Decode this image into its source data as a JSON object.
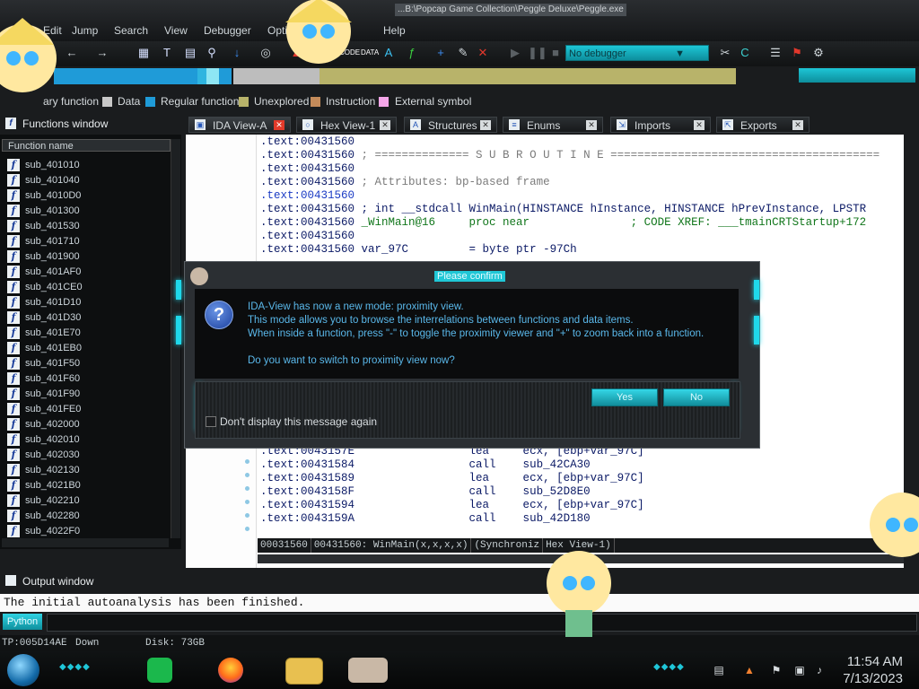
{
  "window": {
    "title_path": "...B:\\Popcap Game Collection\\Peggle Deluxe\\Peggle.exe"
  },
  "menu": [
    "Edit",
    "Jump",
    "Search",
    "View",
    "Debugger",
    "Opti",
    "Help"
  ],
  "toolbar": {
    "debugger_combo": "No debugger"
  },
  "legend": [
    {
      "label": "ary function",
      "color": "#e0e0e0"
    },
    {
      "label": "Data",
      "color": "#c8c8c8"
    },
    {
      "label": "Regular function",
      "color": "#1f9bd8"
    },
    {
      "label": "Unexplored",
      "color": "#b8b36a"
    },
    {
      "label": "Instruction",
      "color": "#c48b5a"
    },
    {
      "label": "External symbol",
      "color": "#f4a6e8"
    }
  ],
  "functions_window": {
    "title": "Functions window",
    "column": "Function name",
    "items": [
      "sub_401010",
      "sub_401040",
      "sub_4010D0",
      "sub_401300",
      "sub_401530",
      "sub_401710",
      "sub_401900",
      "sub_401AF0",
      "sub_401CE0",
      "sub_401D10",
      "sub_401D30",
      "sub_401E70",
      "sub_401EB0",
      "sub_401F50",
      "sub_401F60",
      "sub_401F90",
      "sub_401FE0",
      "sub_402000",
      "sub_402010",
      "sub_402030",
      "sub_402130",
      "sub_4021B0",
      "sub_402210",
      "sub_402280",
      "sub_4022F0"
    ]
  },
  "tabs": [
    {
      "label": "IDA View-A",
      "icon": "ida-view-icon",
      "active": true
    },
    {
      "label": "Hex View-1",
      "icon": "hex-view-icon"
    },
    {
      "label": "Structures",
      "icon": "structures-icon"
    },
    {
      "label": "Enums",
      "icon": "enums-icon"
    },
    {
      "label": "Imports",
      "icon": "imports-icon"
    },
    {
      "label": "Exports",
      "icon": "exports-icon"
    }
  ],
  "code": {
    "top": [
      {
        "a": ".text:00431560",
        "b": ""
      },
      {
        "a": ".text:00431560",
        "b": " ; ============== S U B R O U T I N E ========================================"
      },
      {
        "a": ".text:00431560",
        "b": ""
      },
      {
        "a": ".text:00431560",
        "b": " ; Attributes: bp-based frame"
      },
      {
        "a": ".text:00431560",
        "b": ""
      },
      {
        "a": ".text:00431560",
        "b": " ; int __stdcall WinMain(HINSTANCE hInstance, HINSTANCE hPrevInstance, LPSTR"
      },
      {
        "a": ".text:00431560",
        "b": " _WinMain@16     proc near               ; CODE XREF: ___tmainCRTStartup+172"
      },
      {
        "a": ".text:00431560",
        "b": ""
      },
      {
        "a": ".text:00431560",
        "b": " var_97C         = byte ptr -97Ch"
      }
    ],
    "bottom": [
      {
        "a": ".text:0043157E",
        "b": "                 lea     ecx, [ebp+var_97C]"
      },
      {
        "a": ".text:00431584",
        "b": "                 call    sub_42CA30"
      },
      {
        "a": ".text:00431589",
        "b": "                 lea     ecx, [ebp+var_97C]"
      },
      {
        "a": ".text:0043158F",
        "b": "                 call    sub_52D8E0"
      },
      {
        "a": ".text:00431594",
        "b": "                 lea     ecx, [ebp+var_97C]"
      },
      {
        "a": ".text:0043159A",
        "b": "                 call    sub_42D180"
      }
    ],
    "status": [
      "00031560",
      "00431560: WinMain(x,x,x,x)",
      "(Synchroniz",
      "Hex View-1)"
    ]
  },
  "dialog": {
    "title": "Please confirm",
    "lines": [
      "IDA-View has now a new mode: proximity view.",
      "This mode allows you to browse the interrelations between functions and data items.",
      "When inside a function, press \"-\" to toggle the proximity viewer and \"+\" to zoom back into a function.",
      "Do you want to switch to proximity view now?"
    ],
    "yes": "Yes",
    "no": "No",
    "checkbox": "Don't display this message again"
  },
  "output": {
    "title": "Output window",
    "line": "The initial autoanalysis has been finished.",
    "python_button": "Python"
  },
  "infobar": {
    "ea": "TP:005D14AE",
    "dir": "Down",
    "disk": "Disk: 73GB"
  },
  "clock": {
    "time": "11:54 AM",
    "date": "7/13/2023"
  }
}
